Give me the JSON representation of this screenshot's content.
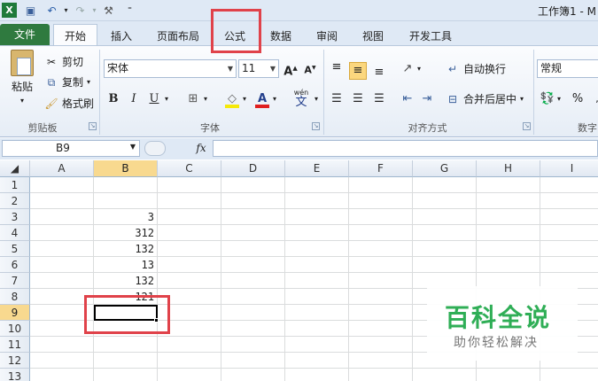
{
  "window": {
    "title": "工作簿1 - M"
  },
  "tabs": [
    "文件",
    "开始",
    "插入",
    "页面布局",
    "公式",
    "数据",
    "审阅",
    "视图",
    "开发工具"
  ],
  "clipboard": {
    "paste": "粘贴",
    "cut": "剪切",
    "copy": "复制",
    "format_painter": "格式刷",
    "group_label": "剪贴板"
  },
  "font": {
    "name": "宋体",
    "size": "11",
    "grow": "A",
    "shrink": "A",
    "bold": "B",
    "italic": "I",
    "underline": "U",
    "color_letter": "A",
    "phonetic": "文",
    "phonetic_top": "wén",
    "group_label": "字体"
  },
  "alignment": {
    "wrap_text": "自动换行",
    "merge_center": "合并后居中",
    "group_label": "对齐方式"
  },
  "number": {
    "format": "常规",
    "percent": "%",
    "group_label": "数字"
  },
  "formula_bar": {
    "name_box": "B9",
    "fx": "fx",
    "value": ""
  },
  "grid": {
    "columns": [
      "A",
      "B",
      "C",
      "D",
      "E",
      "F",
      "G",
      "H",
      "I"
    ],
    "rows": [
      "1",
      "2",
      "3",
      "4",
      "5",
      "6",
      "7",
      "8",
      "9",
      "10",
      "11",
      "12",
      "13"
    ],
    "selected_cell": "B9",
    "column_b_values": [
      "",
      "",
      "3",
      "312",
      "132",
      "13",
      "132",
      "121",
      "",
      "",
      "",
      "",
      ""
    ]
  },
  "watermark": {
    "title": "百科全说",
    "subtitle": "助你轻松解决"
  },
  "colors": {
    "file_tab": "#2f7a3f",
    "highlight": "#e0424a",
    "selected_header": "#f8d98f",
    "watermark": "#2fae56"
  }
}
